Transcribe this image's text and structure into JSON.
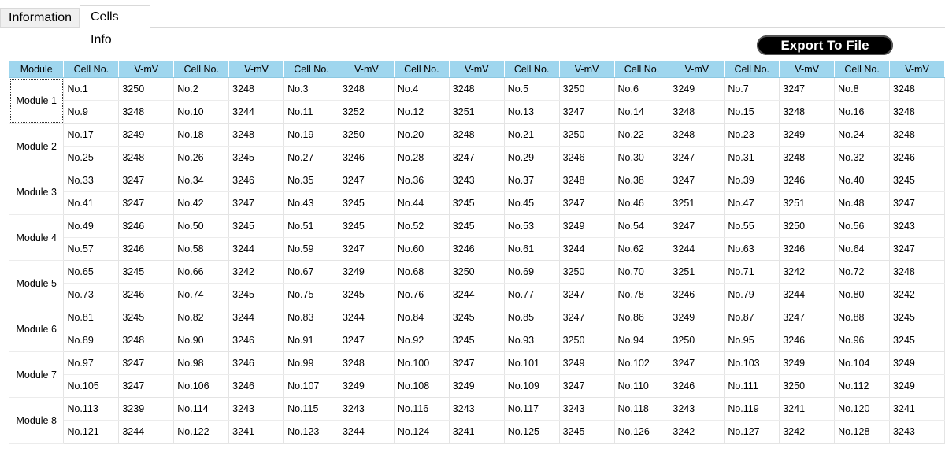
{
  "tabs": [
    {
      "label": "Information",
      "active": false
    },
    {
      "label": "Cells Info",
      "active": true
    }
  ],
  "export_button": "Export To File",
  "table": {
    "module_header": "Module",
    "cell_header": "Cell No.",
    "voltage_header": "V-mV",
    "column_groups": 8,
    "modules": [
      {
        "name": "Module 1",
        "rows": [
          [
            [
              "No.1",
              3250
            ],
            [
              "No.2",
              3248
            ],
            [
              "No.3",
              3248
            ],
            [
              "No.4",
              3248
            ],
            [
              "No.5",
              3250
            ],
            [
              "No.6",
              3249
            ],
            [
              "No.7",
              3247
            ],
            [
              "No.8",
              3248
            ]
          ],
          [
            [
              "No.9",
              3248
            ],
            [
              "No.10",
              3244
            ],
            [
              "No.11",
              3252
            ],
            [
              "No.12",
              3251
            ],
            [
              "No.13",
              3247
            ],
            [
              "No.14",
              3248
            ],
            [
              "No.15",
              3248
            ],
            [
              "No.16",
              3248
            ]
          ]
        ]
      },
      {
        "name": "Module 2",
        "rows": [
          [
            [
              "No.17",
              3249
            ],
            [
              "No.18",
              3248
            ],
            [
              "No.19",
              3250
            ],
            [
              "No.20",
              3248
            ],
            [
              "No.21",
              3250
            ],
            [
              "No.22",
              3248
            ],
            [
              "No.23",
              3249
            ],
            [
              "No.24",
              3248
            ]
          ],
          [
            [
              "No.25",
              3248
            ],
            [
              "No.26",
              3245
            ],
            [
              "No.27",
              3246
            ],
            [
              "No.28",
              3247
            ],
            [
              "No.29",
              3246
            ],
            [
              "No.30",
              3247
            ],
            [
              "No.31",
              3248
            ],
            [
              "No.32",
              3246
            ]
          ]
        ]
      },
      {
        "name": "Module 3",
        "rows": [
          [
            [
              "No.33",
              3247
            ],
            [
              "No.34",
              3246
            ],
            [
              "No.35",
              3247
            ],
            [
              "No.36",
              3243
            ],
            [
              "No.37",
              3248
            ],
            [
              "No.38",
              3247
            ],
            [
              "No.39",
              3246
            ],
            [
              "No.40",
              3245
            ]
          ],
          [
            [
              "No.41",
              3247
            ],
            [
              "No.42",
              3247
            ],
            [
              "No.43",
              3245
            ],
            [
              "No.44",
              3245
            ],
            [
              "No.45",
              3247
            ],
            [
              "No.46",
              3251
            ],
            [
              "No.47",
              3251
            ],
            [
              "No.48",
              3247
            ]
          ]
        ]
      },
      {
        "name": "Module 4",
        "rows": [
          [
            [
              "No.49",
              3246
            ],
            [
              "No.50",
              3245
            ],
            [
              "No.51",
              3245
            ],
            [
              "No.52",
              3245
            ],
            [
              "No.53",
              3249
            ],
            [
              "No.54",
              3247
            ],
            [
              "No.55",
              3250
            ],
            [
              "No.56",
              3243
            ]
          ],
          [
            [
              "No.57",
              3246
            ],
            [
              "No.58",
              3244
            ],
            [
              "No.59",
              3247
            ],
            [
              "No.60",
              3246
            ],
            [
              "No.61",
              3244
            ],
            [
              "No.62",
              3244
            ],
            [
              "No.63",
              3246
            ],
            [
              "No.64",
              3247
            ]
          ]
        ]
      },
      {
        "name": "Module 5",
        "rows": [
          [
            [
              "No.65",
              3245
            ],
            [
              "No.66",
              3242
            ],
            [
              "No.67",
              3249
            ],
            [
              "No.68",
              3250
            ],
            [
              "No.69",
              3250
            ],
            [
              "No.70",
              3251
            ],
            [
              "No.71",
              3242
            ],
            [
              "No.72",
              3248
            ]
          ],
          [
            [
              "No.73",
              3246
            ],
            [
              "No.74",
              3245
            ],
            [
              "No.75",
              3245
            ],
            [
              "No.76",
              3244
            ],
            [
              "No.77",
              3247
            ],
            [
              "No.78",
              3246
            ],
            [
              "No.79",
              3244
            ],
            [
              "No.80",
              3242
            ]
          ]
        ]
      },
      {
        "name": "Module 6",
        "rows": [
          [
            [
              "No.81",
              3245
            ],
            [
              "No.82",
              3244
            ],
            [
              "No.83",
              3244
            ],
            [
              "No.84",
              3245
            ],
            [
              "No.85",
              3247
            ],
            [
              "No.86",
              3249
            ],
            [
              "No.87",
              3247
            ],
            [
              "No.88",
              3245
            ]
          ],
          [
            [
              "No.89",
              3248
            ],
            [
              "No.90",
              3246
            ],
            [
              "No.91",
              3247
            ],
            [
              "No.92",
              3245
            ],
            [
              "No.93",
              3250
            ],
            [
              "No.94",
              3250
            ],
            [
              "No.95",
              3246
            ],
            [
              "No.96",
              3245
            ]
          ]
        ]
      },
      {
        "name": "Module 7",
        "rows": [
          [
            [
              "No.97",
              3247
            ],
            [
              "No.98",
              3246
            ],
            [
              "No.99",
              3248
            ],
            [
              "No.100",
              3247
            ],
            [
              "No.101",
              3249
            ],
            [
              "No.102",
              3247
            ],
            [
              "No.103",
              3249
            ],
            [
              "No.104",
              3249
            ]
          ],
          [
            [
              "No.105",
              3247
            ],
            [
              "No.106",
              3246
            ],
            [
              "No.107",
              3249
            ],
            [
              "No.108",
              3249
            ],
            [
              "No.109",
              3247
            ],
            [
              "No.110",
              3246
            ],
            [
              "No.111",
              3250
            ],
            [
              "No.112",
              3249
            ]
          ]
        ]
      },
      {
        "name": "Module 8",
        "rows": [
          [
            [
              "No.113",
              3239
            ],
            [
              "No.114",
              3243
            ],
            [
              "No.115",
              3243
            ],
            [
              "No.116",
              3243
            ],
            [
              "No.117",
              3243
            ],
            [
              "No.118",
              3243
            ],
            [
              "No.119",
              3241
            ],
            [
              "No.120",
              3241
            ]
          ],
          [
            [
              "No.121",
              3244
            ],
            [
              "No.122",
              3241
            ],
            [
              "No.123",
              3244
            ],
            [
              "No.124",
              3241
            ],
            [
              "No.125",
              3245
            ],
            [
              "No.126",
              3242
            ],
            [
              "No.127",
              3242
            ],
            [
              "No.128",
              3243
            ]
          ]
        ]
      }
    ]
  }
}
